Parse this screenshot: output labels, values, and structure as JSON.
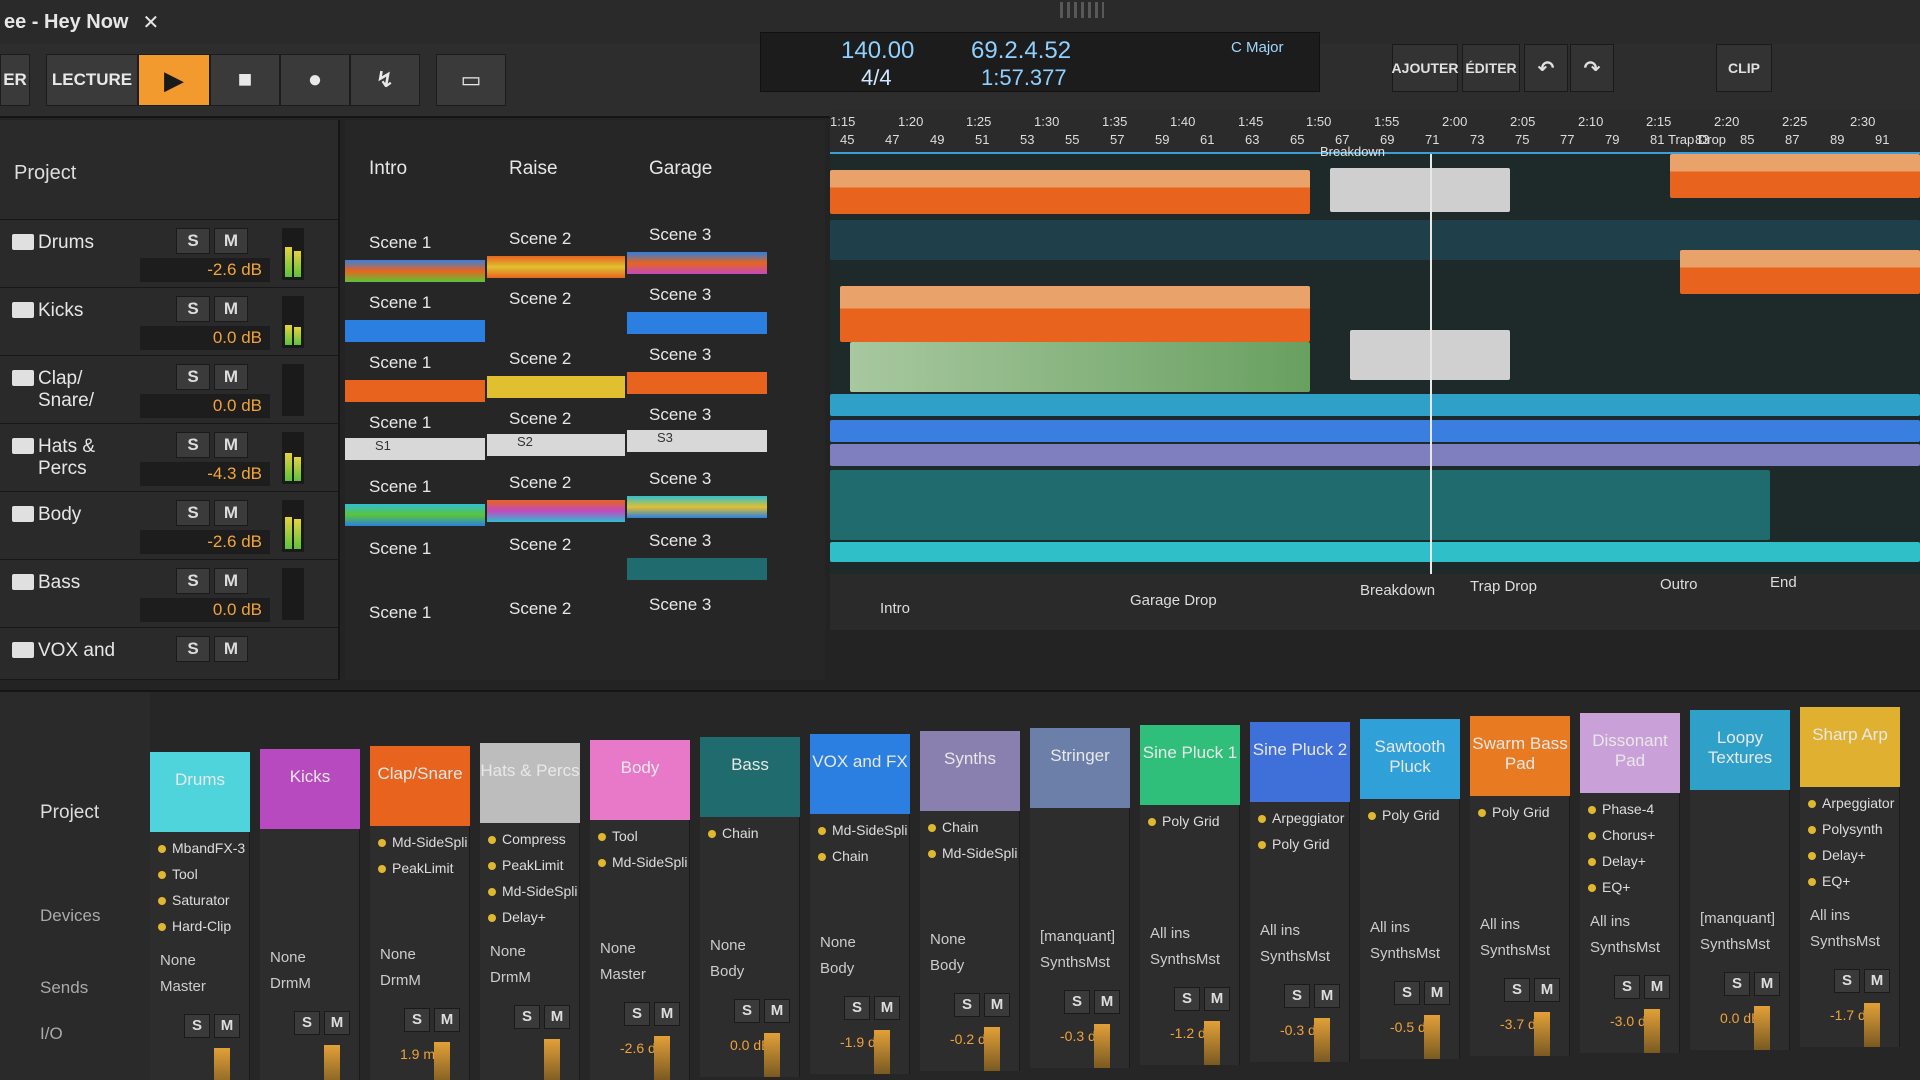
{
  "window": {
    "title": "ee - Hey Now",
    "close": "✕"
  },
  "toolbar": {
    "mode_edge": "ER",
    "play_label": "LECTURE",
    "play_icon": "▶",
    "stop_icon": "■",
    "record_icon": "●",
    "automation_icon": "↯",
    "arrange_icon": "▭"
  },
  "transport": {
    "tempo": "140.00",
    "time_signature": "4/4",
    "position_bars": "69.2.4.52",
    "position_time": "1:57.377",
    "key": "C Major"
  },
  "right_buttons": {
    "add": "AJOUTER",
    "edit": "ÉDITER",
    "undo": "↶",
    "redo": "↷",
    "clip": "CLIP"
  },
  "sidebar": {
    "project": "Project",
    "tracks": [
      {
        "name": "Drums",
        "s": "S",
        "m": "M",
        "db": "-2.6 dB"
      },
      {
        "name": "Kicks",
        "s": "S",
        "m": "M",
        "db": "0.0 dB"
      },
      {
        "name": "Clap/ Snare/",
        "s": "S",
        "m": "M",
        "db": "0.0 dB"
      },
      {
        "name": "Hats & Percs",
        "s": "S",
        "m": "M",
        "db": "-4.3 dB"
      },
      {
        "name": "Body",
        "s": "S",
        "m": "M",
        "db": "-2.6 dB"
      },
      {
        "name": "Bass",
        "s": "S",
        "m": "M",
        "db": "0.0 dB"
      },
      {
        "name": "VOX and",
        "s": "S",
        "m": "M",
        "db": ""
      }
    ]
  },
  "clip_launcher": {
    "headers": [
      "Intro",
      "Raise",
      "Garage"
    ],
    "scenes": [
      "Scene 1",
      "Scene 2",
      "Scene 3"
    ],
    "short": [
      "S1",
      "S2",
      "S3"
    ]
  },
  "ruler": {
    "times": [
      "1:15",
      "1:20",
      "1:25",
      "1:30",
      "1:35",
      "1:40",
      "1:45",
      "1:50",
      "1:55",
      "2:00",
      "2:05",
      "2:10",
      "2:15",
      "2:20",
      "2:25",
      "2:30"
    ],
    "bars": [
      "45",
      "47",
      "49",
      "51",
      "53",
      "55",
      "57",
      "59",
      "61",
      "63",
      "65",
      "67",
      "69",
      "71",
      "73",
      "75",
      "77",
      "79",
      "81",
      "83",
      "85",
      "87",
      "89",
      "91"
    ],
    "markers": [
      "Breakdown",
      "Trap Drop"
    ]
  },
  "arranger_markers": [
    "Intro",
    "Garage Drop",
    "Breakdown",
    "Trap Drop",
    "Outro",
    "End"
  ],
  "mixer": {
    "left": {
      "project": "Project",
      "devices": "Devices",
      "sends": "Sends",
      "io": "I/O"
    },
    "strips": [
      {
        "name": "Drums",
        "color": "#4fd4dc",
        "devices": [
          "MbandFX-3",
          "Tool",
          "Saturator",
          "Hard-Clip"
        ],
        "send1": "None",
        "send2": "Master",
        "vol": ""
      },
      {
        "name": "Kicks",
        "color": "#b84ac0",
        "devices": [],
        "send1": "None",
        "send2": "DrmM",
        "vol": ""
      },
      {
        "name": "Clap/Snare",
        "color": "#e8641e",
        "devices": [
          "Md-SideSpli",
          "PeakLimit"
        ],
        "send1": "None",
        "send2": "DrmM",
        "vol": "1.9 ms"
      },
      {
        "name": "Hats & Percs",
        "color": "#bdbdbd",
        "devices": [
          "Compress",
          "PeakLimit",
          "Md-SideSpli",
          "Delay+"
        ],
        "send1": "None",
        "send2": "DrmM",
        "vol": ""
      },
      {
        "name": "Body",
        "color": "#e879c8",
        "devices": [
          "Tool",
          "Md-SideSpli"
        ],
        "send1": "None",
        "send2": "Master",
        "vol": "-2.6 dB"
      },
      {
        "name": "Bass",
        "color": "#1f6b6e",
        "devices": [
          "Chain"
        ],
        "send1": "None",
        "send2": "Body",
        "vol": "0.0 dB"
      },
      {
        "name": "VOX and FX",
        "color": "#2a7fe0",
        "devices": [
          "Md-SideSpli",
          "Chain"
        ],
        "send1": "None",
        "send2": "Body",
        "vol": "-1.9 dB"
      },
      {
        "name": "Synths",
        "color": "#8a80b0",
        "devices": [
          "Chain",
          "Md-SideSpli"
        ],
        "send1": "None",
        "send2": "Body",
        "vol": "-0.2 dB"
      },
      {
        "name": "Stringer",
        "color": "#6c7fa8",
        "devices": [],
        "send1": "[manquant]",
        "send2": "SynthsMst",
        "vol": "-0.3 dB"
      },
      {
        "name": "Sine Pluck 1",
        "color": "#2fbf7a",
        "devices": [
          "Poly Grid"
        ],
        "send1": "All ins",
        "send2": "SynthsMst",
        "vol": "-1.2 dB"
      },
      {
        "name": "Sine Pluck 2",
        "color": "#3f6fd8",
        "devices": [
          "Arpeggiator",
          "Poly Grid"
        ],
        "send1": "All ins",
        "send2": "SynthsMst",
        "vol": "-0.3 dB"
      },
      {
        "name": "Sawtooth Pluck",
        "color": "#2fa0d8",
        "devices": [
          "Poly Grid"
        ],
        "send1": "All ins",
        "send2": "SynthsMst",
        "vol": "-0.5 dB"
      },
      {
        "name": "Swarm Bass Pad",
        "color": "#e87a22",
        "devices": [
          "Poly Grid"
        ],
        "send1": "All ins",
        "send2": "SynthsMst",
        "vol": "-3.7 dB"
      },
      {
        "name": "Dissonant Pad",
        "color": "#c9a0d8",
        "devices": [
          "Phase-4",
          "Chorus+",
          "Delay+",
          "EQ+"
        ],
        "send1": "All ins",
        "send2": "SynthsMst",
        "vol": "-3.0 dB"
      },
      {
        "name": "Loopy Textures",
        "color": "#2fa0c8",
        "devices": [],
        "send1": "[manquant]",
        "send2": "SynthsMst",
        "vol": "0.0 dB"
      },
      {
        "name": "Sharp Arp",
        "color": "#e0b030",
        "devices": [
          "Arpeggiator",
          "Polysynth",
          "Delay+",
          "EQ+"
        ],
        "send1": "All ins",
        "send2": "SynthsMst",
        "vol": "-1.7 dB"
      }
    ]
  }
}
